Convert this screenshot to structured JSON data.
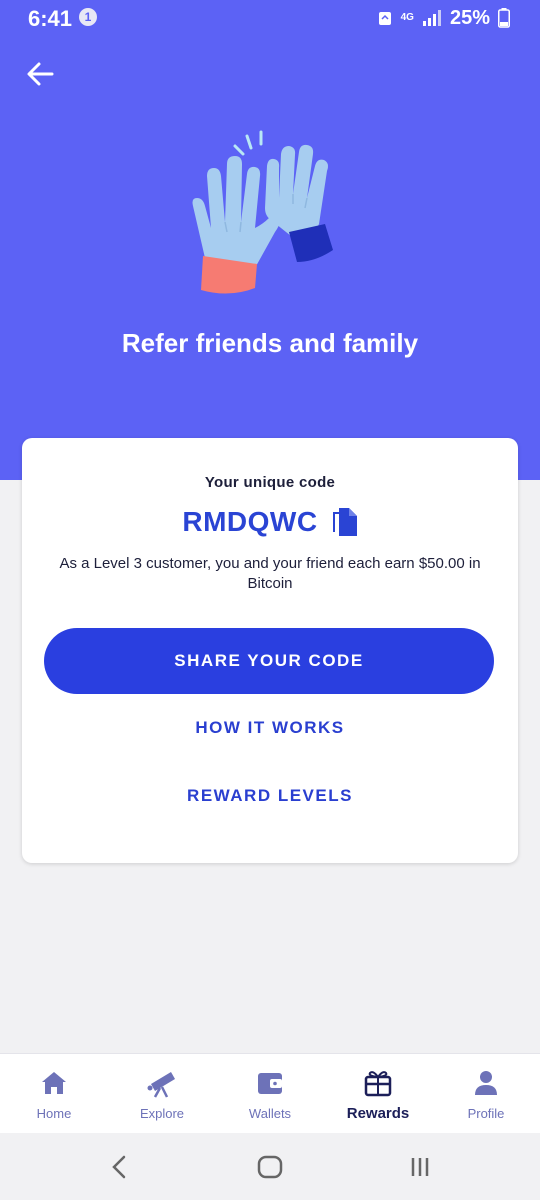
{
  "status_bar": {
    "time": "6:41",
    "notification_count": "1",
    "network": "4G",
    "battery": "25%"
  },
  "hero": {
    "title": "Refer friends and family",
    "back_icon": "arrow-left-icon",
    "illustration": "high-five-hands"
  },
  "card": {
    "code_label": "Your unique code",
    "code": "RMDQWC",
    "copy_icon": "copy-icon",
    "description": "As a Level 3 customer, you and your friend each earn $50.00 in Bitcoin",
    "share_label": "SHARE YOUR CODE",
    "how_label": "HOW IT WORKS",
    "levels_label": "REWARD LEVELS"
  },
  "bottom_nav": {
    "items": [
      {
        "label": "Home",
        "icon": "home-icon"
      },
      {
        "label": "Explore",
        "icon": "telescope-icon"
      },
      {
        "label": "Wallets",
        "icon": "wallet-icon"
      },
      {
        "label": "Rewards",
        "icon": "gift-icon",
        "active": true
      },
      {
        "label": "Profile",
        "icon": "person-icon"
      }
    ]
  },
  "colors": {
    "brand": "#5c62f5",
    "primary_button": "#2a3fe0",
    "link": "#2a3fd0",
    "nav_inactive": "#6d72b8",
    "nav_active": "#1c1f59"
  }
}
